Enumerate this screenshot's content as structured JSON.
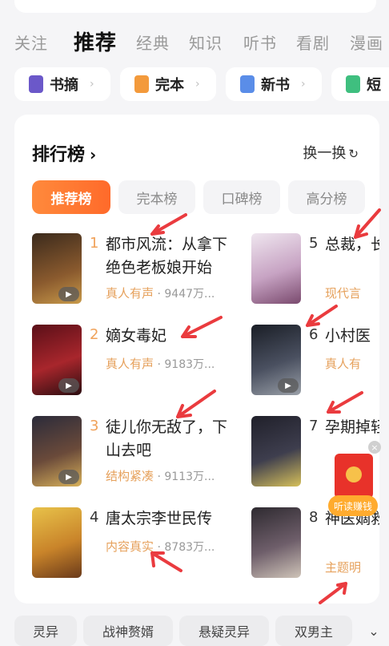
{
  "nav_tabs": [
    "关注",
    "推荐",
    "经典",
    "知识",
    "听书",
    "看剧",
    "漫画"
  ],
  "quick_links": [
    {
      "label": "书摘",
      "icon": "bookmark-icon"
    },
    {
      "label": "完本",
      "icon": "book-complete-icon"
    },
    {
      "label": "新书",
      "icon": "flag-icon"
    },
    {
      "label": "短",
      "icon": "document-icon"
    }
  ],
  "ranking": {
    "title": "排行榜",
    "refresh_label": "换一换",
    "tabs": [
      "推荐榜",
      "完本榜",
      "口碑榜",
      "高分榜"
    ],
    "books": [
      {
        "rank": "1",
        "title": "都市风流：从拿下绝色老板娘开始",
        "tag": "真人有声",
        "count": "9447万..."
      },
      {
        "rank": "2",
        "title": "嫡女毒妃",
        "tag": "真人有声",
        "count": "9183万..."
      },
      {
        "rank": "3",
        "title": "徒儿你无敌了，下山去吧",
        "tag": "结构紧凑",
        "count": "9113万..."
      },
      {
        "rank": "4",
        "title": "唐太宗李世民传",
        "tag": "内容真实",
        "count": "8783万..."
      },
      {
        "rank": "5",
        "title": "总裁，长得好",
        "tag": "现代言",
        "count": ""
      },
      {
        "rank": "6",
        "title": "小村医",
        "tag": "真人有",
        "count": ""
      },
      {
        "rank": "7",
        "title": "孕期掉轻哄她",
        "tag": "",
        "count": ""
      },
      {
        "rank": "8",
        "title": "神医嫡救了满",
        "tag": "主题明",
        "count": ""
      }
    ]
  },
  "float_widget": {
    "label": "听读赚钱",
    "close": "×"
  },
  "genres": [
    "灵异",
    "战神赘婿",
    "悬疑灵异",
    "双男主"
  ],
  "colors": {
    "accent": "#ff7a33",
    "tag": "#e6a15c",
    "annotation": "#e8262a"
  }
}
